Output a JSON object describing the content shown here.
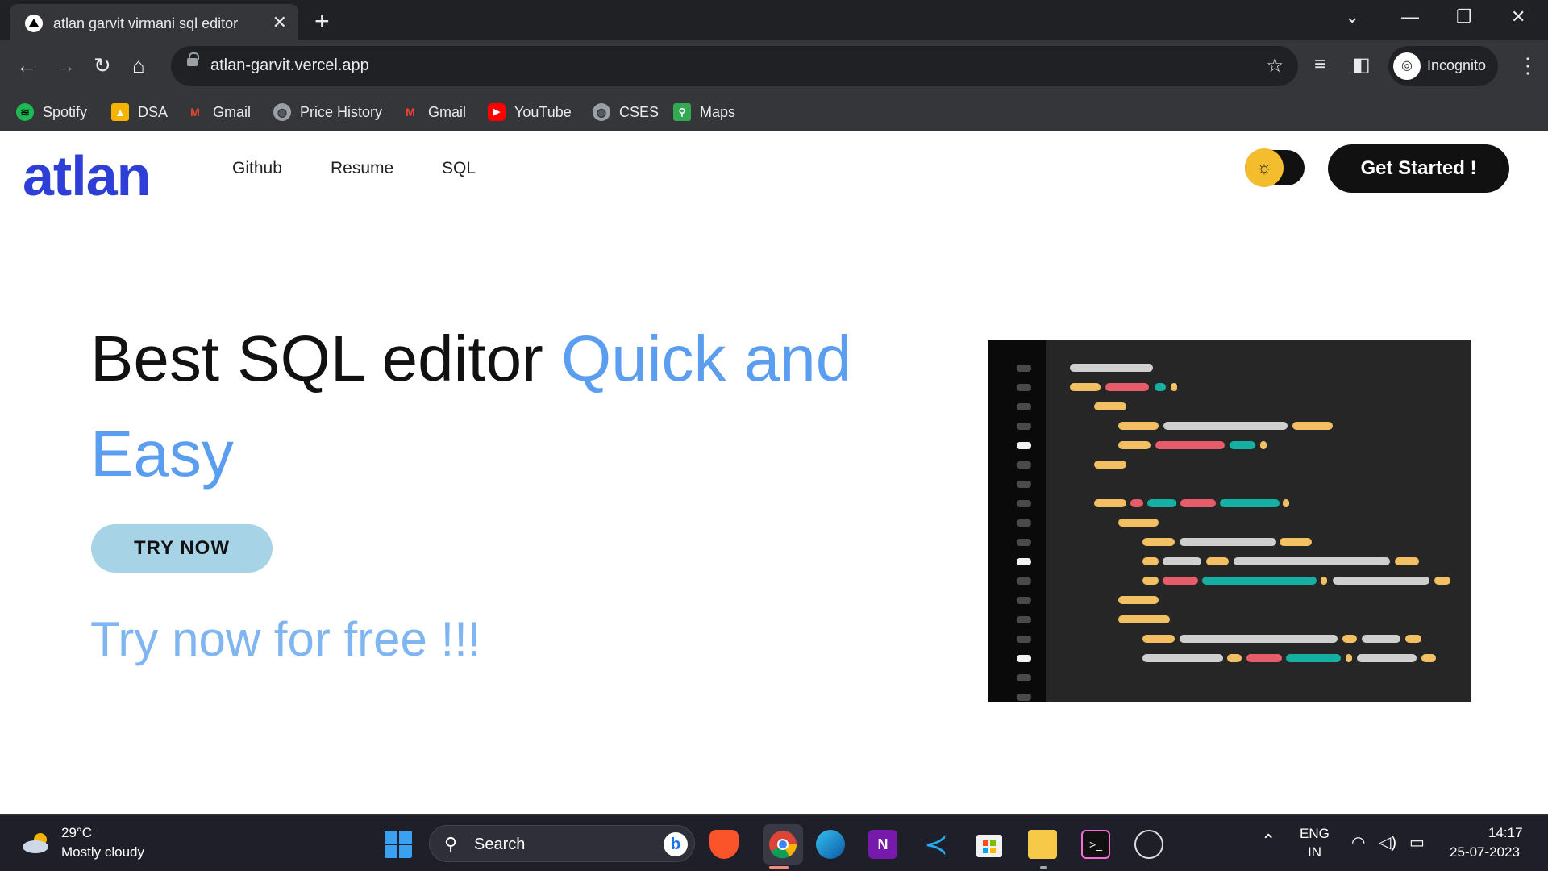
{
  "browser": {
    "tab_title": "atlan garvit virmani sql editor",
    "url": "atlan-garvit.vercel.app",
    "profile_label": "Incognito",
    "bookmarks": [
      {
        "label": "Spotify",
        "color": "#1db954"
      },
      {
        "label": "DSA",
        "color": "#f4b400"
      },
      {
        "label": "Gmail",
        "color": "#ea4335"
      },
      {
        "label": "Price History",
        "color": "#9aa0a6"
      },
      {
        "label": "Gmail",
        "color": "#ea4335"
      },
      {
        "label": "YouTube",
        "color": "#ff0000"
      },
      {
        "label": "CSES",
        "color": "#9aa0a6"
      },
      {
        "label": "Maps",
        "color": "#34a853"
      }
    ]
  },
  "site": {
    "logo": "atlan",
    "nav": [
      "Github",
      "Resume",
      "SQL"
    ],
    "cta_label": "Get Started !",
    "hero_prefix": "Best SQL editor ",
    "hero_accent": "Quick and",
    "hero_accent2": "Easy",
    "try_button": "TRY NOW",
    "free_text": "Try now for free !!!",
    "accent_color": "#5b9ef0",
    "brand_color": "#2d3fd6"
  },
  "taskbar": {
    "temperature": "29°C",
    "weather": "Mostly cloudy",
    "search_label": "Search",
    "lang_top": "ENG",
    "lang_bottom": "IN",
    "time": "14:17",
    "date": "25-07-2023"
  }
}
